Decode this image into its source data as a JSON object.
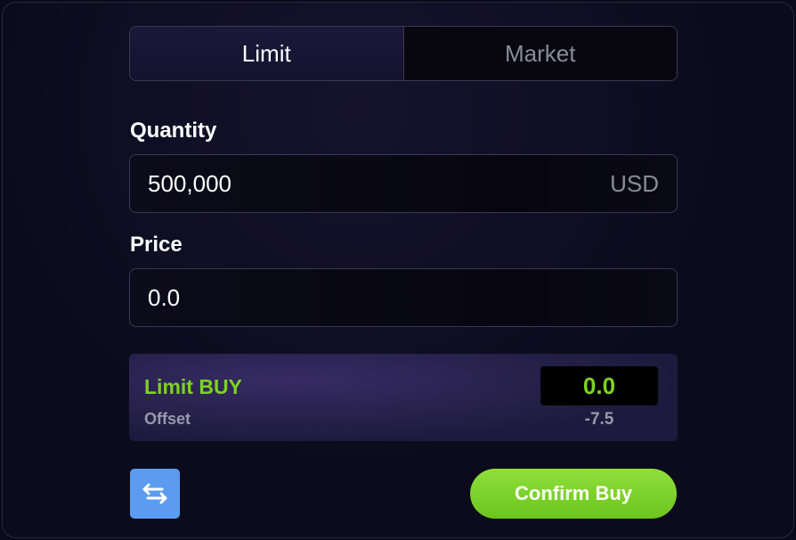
{
  "order_type_tabs": [
    {
      "label": "Limit",
      "active": true
    },
    {
      "label": "Market",
      "active": false
    }
  ],
  "quantity": {
    "label": "Quantity",
    "value": "500,000",
    "unit": "USD"
  },
  "price": {
    "label": "Price",
    "value": "0.0"
  },
  "summary": {
    "title": "Limit BUY",
    "price_value": "0.0",
    "offset_label": "Offset",
    "offset_value": "-7.5"
  },
  "actions": {
    "swap_icon": "swap-arrows-icon",
    "confirm_label": "Confirm Buy"
  },
  "colors": {
    "accent_green": "#7ed321",
    "swap_blue": "#5b9cf0",
    "background": "#0c0b1c"
  }
}
